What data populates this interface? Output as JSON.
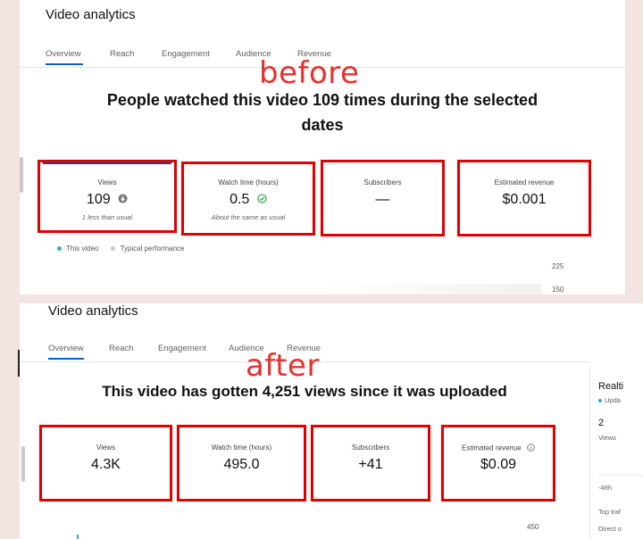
{
  "before": {
    "title": "Video analytics",
    "tabs": [
      "Overview",
      "Reach",
      "Engagement",
      "Audience",
      "Revenue"
    ],
    "overlay_word": "before",
    "headline_line1": "People watched this video 109 times during the selected",
    "headline_line2": "dates",
    "cards": [
      {
        "label": "Views",
        "value": "109",
        "note": "1 less than usual",
        "icon": "down-arrow-circle-icon"
      },
      {
        "label": "Watch time (hours)",
        "value": "0.5",
        "note": "About the same as usual",
        "icon": "check-circle-icon"
      },
      {
        "label": "Subscribers",
        "value": "—",
        "note": ""
      },
      {
        "label": "Estimated revenue",
        "value": "$0.001",
        "note": ""
      }
    ],
    "legend": {
      "this_video": "This video",
      "typical": "Typical performance"
    },
    "axis_ticks": [
      "225",
      "150"
    ]
  },
  "after": {
    "title": "Video analytics",
    "tabs": [
      "Overview",
      "Reach",
      "Engagement",
      "Audience",
      "Revenue"
    ],
    "overlay_word": "after",
    "headline": "This video has gotten 4,251 views since it was uploaded",
    "cards": [
      {
        "label": "Views",
        "value": "4.3K"
      },
      {
        "label": "Watch time (hours)",
        "value": "495.0"
      },
      {
        "label": "Subscribers",
        "value": "+41"
      },
      {
        "label": "Estimated revenue",
        "value": "$0.09",
        "icon": "info-icon"
      }
    ],
    "axis_ticks": [
      "450"
    ],
    "realtime": {
      "title": "Realti",
      "updating": "Upda",
      "value": "2",
      "views_label": "Views",
      "axis_label": "-48h",
      "top_traffic": "Top traf",
      "direct": "Direct o"
    }
  },
  "colors": {
    "highlight_border": "#e00000",
    "accent_blue": "#065fd4",
    "overlay_red": "#e8302c",
    "background": "#f3e4e1"
  }
}
